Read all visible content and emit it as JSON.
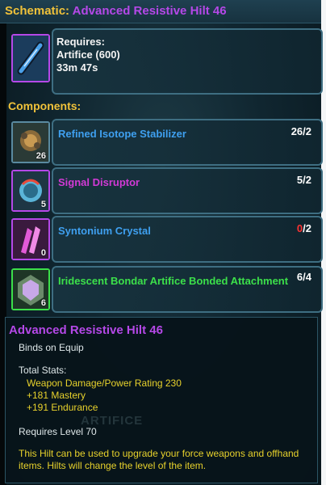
{
  "header": {
    "label": "Schematic:",
    "name": "Advanced Resistive Hilt 46"
  },
  "schematic": {
    "requires_label": "Requires:",
    "skill": "Artifice (600)",
    "time": "33m 47s"
  },
  "components": {
    "title": "Components:",
    "items": [
      {
        "name": "Refined Isotope Stabilizer",
        "count": "26",
        "qty_have": "26",
        "qty_need": "/2",
        "name_color": "#3fa0f0",
        "have_color": "#ffffff"
      },
      {
        "name": "Signal Disruptor",
        "count": "5",
        "qty_have": "5",
        "qty_need": "/2",
        "name_color": "#d23ad6",
        "have_color": "#ffffff"
      },
      {
        "name": "Syntonium Crystal",
        "count": "0",
        "qty_have": "0",
        "qty_need": "/2",
        "name_color": "#3fa0f0",
        "have_color": "#ff3333"
      },
      {
        "name": "Iridescent Bondar Artifice Bonded Attachment",
        "count": "6",
        "qty_have": "6",
        "qty_need": "/4",
        "name_color": "#3ce04a",
        "have_color": "#ffffff"
      }
    ]
  },
  "tooltip": {
    "title": "Advanced Resistive Hilt 46",
    "binds": "Binds on Equip",
    "total_stats_label": "Total Stats:",
    "stats": [
      "Weapon Damage/Power Rating 230",
      "+181 Mastery",
      "+191 Endurance"
    ],
    "requires_level": "Requires Level 70",
    "description": "This Hilt can be used to upgrade your force weapons and offhand items. Hilts will change the level of the item.",
    "ghost": "ARTIFICE"
  }
}
